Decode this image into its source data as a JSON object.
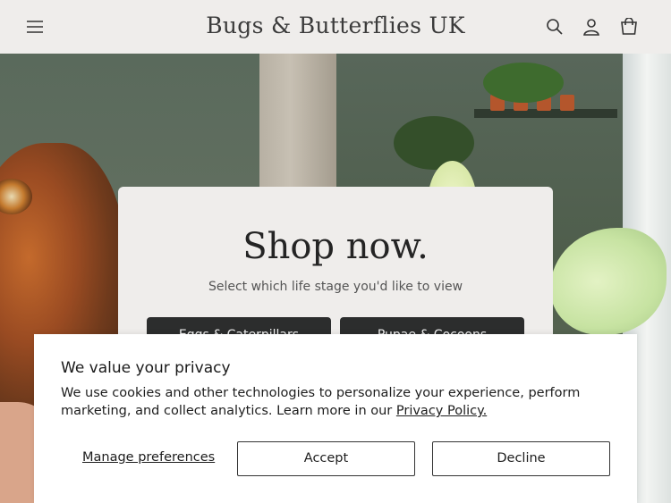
{
  "header": {
    "brand": "Bugs & Butterflies UK",
    "icons": [
      "menu-icon",
      "search-icon",
      "account-icon",
      "cart-icon"
    ]
  },
  "hero": {
    "title": "Shop now.",
    "subtitle": "Select which life stage you'd like to view",
    "buttons": [
      "Eggs & Caterpillars",
      "Pupae & Cocoons"
    ]
  },
  "cookie": {
    "title": "We value your privacy",
    "text": "We use cookies and other technologies to personalize your experience, perform marketing, and collect analytics. Learn more in our ",
    "link": "Privacy Policy.",
    "manage": "Manage preferences",
    "accept": "Accept",
    "decline": "Decline"
  },
  "colors": {
    "header_bg": "#efedeb",
    "button_dark": "#2c2d2d",
    "banner_bg": "#ffffff"
  }
}
